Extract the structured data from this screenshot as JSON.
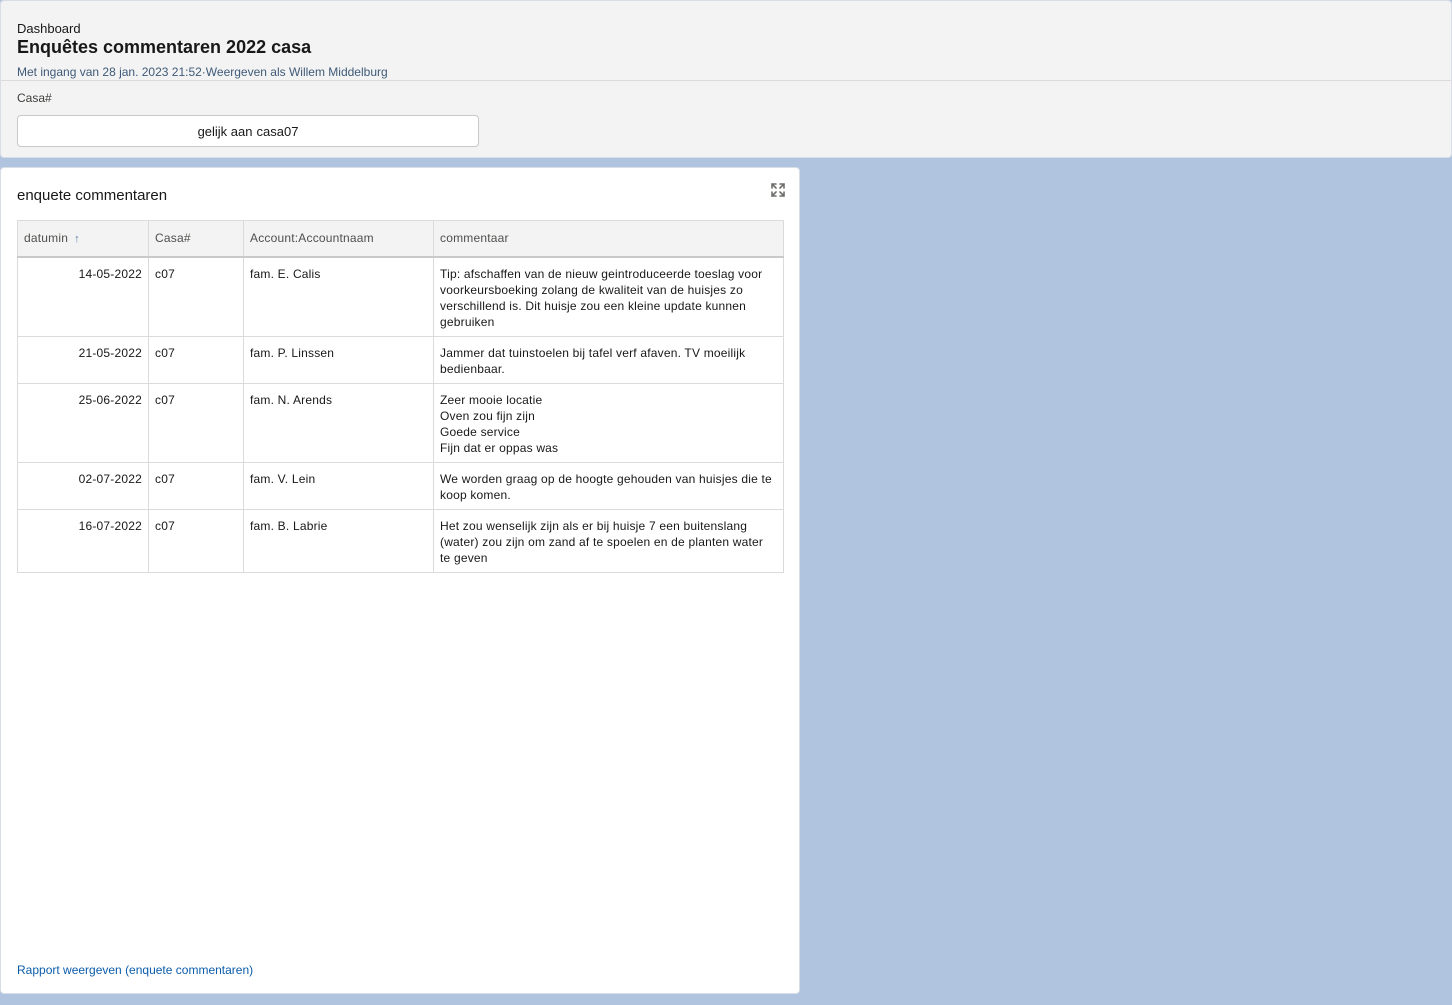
{
  "header": {
    "eyebrow": "Dashboard",
    "title": "Enquêtes commentaren 2022 casa",
    "subtitle": "Met ingang van 28 jan. 2023 21:52·Weergeven als Willem Middelburg"
  },
  "filter": {
    "label": "Casa#",
    "operator": "gelijk aan",
    "value": "casa07"
  },
  "card": {
    "title": "enquete commentaren",
    "footer_link": "Rapport weergeven (enquete commentaren)",
    "columns": [
      "datumin",
      "Casa#",
      "Account:Accountnaam",
      "commentaar"
    ],
    "rows": [
      {
        "date": "14-05-2022",
        "casa": "c07",
        "account": "fam. E. Calis",
        "comment": "Tip: afschaffen van de nieuw geintroduceerde toeslag voor voorkeursboeking zolang de kwaliteit van de huisjes zo verschillend is. Dit huisje zou een kleine update kunnen gebruiken"
      },
      {
        "date": "21-05-2022",
        "casa": "c07",
        "account": "fam. P. Linssen",
        "comment": "Jammer dat tuinstoelen bij tafel verf afaven. TV moeilijk bedienbaar."
      },
      {
        "date": "25-06-2022",
        "casa": "c07",
        "account": "fam. N. Arends",
        "comment": "Zeer mooie locatie\nOven zou fijn zijn\nGoede service\nFijn dat er oppas was"
      },
      {
        "date": "02-07-2022",
        "casa": "c07",
        "account": "fam. V. Lein",
        "comment": "We worden graag op de hoogte gehouden van huisjes die te koop komen."
      },
      {
        "date": "16-07-2022",
        "casa": "c07",
        "account": "fam. B. Labrie",
        "comment": "Het zou wenselijk zijn als er bij huisje 7 een buitenslang (water) zou zijn om zand af te spoelen en de planten water te geven"
      }
    ]
  },
  "icons": {
    "sort": "arrow-up-icon",
    "expand": "expand-icon"
  },
  "colors": {
    "link": "#0b5cab",
    "background": "#b0c4df"
  }
}
